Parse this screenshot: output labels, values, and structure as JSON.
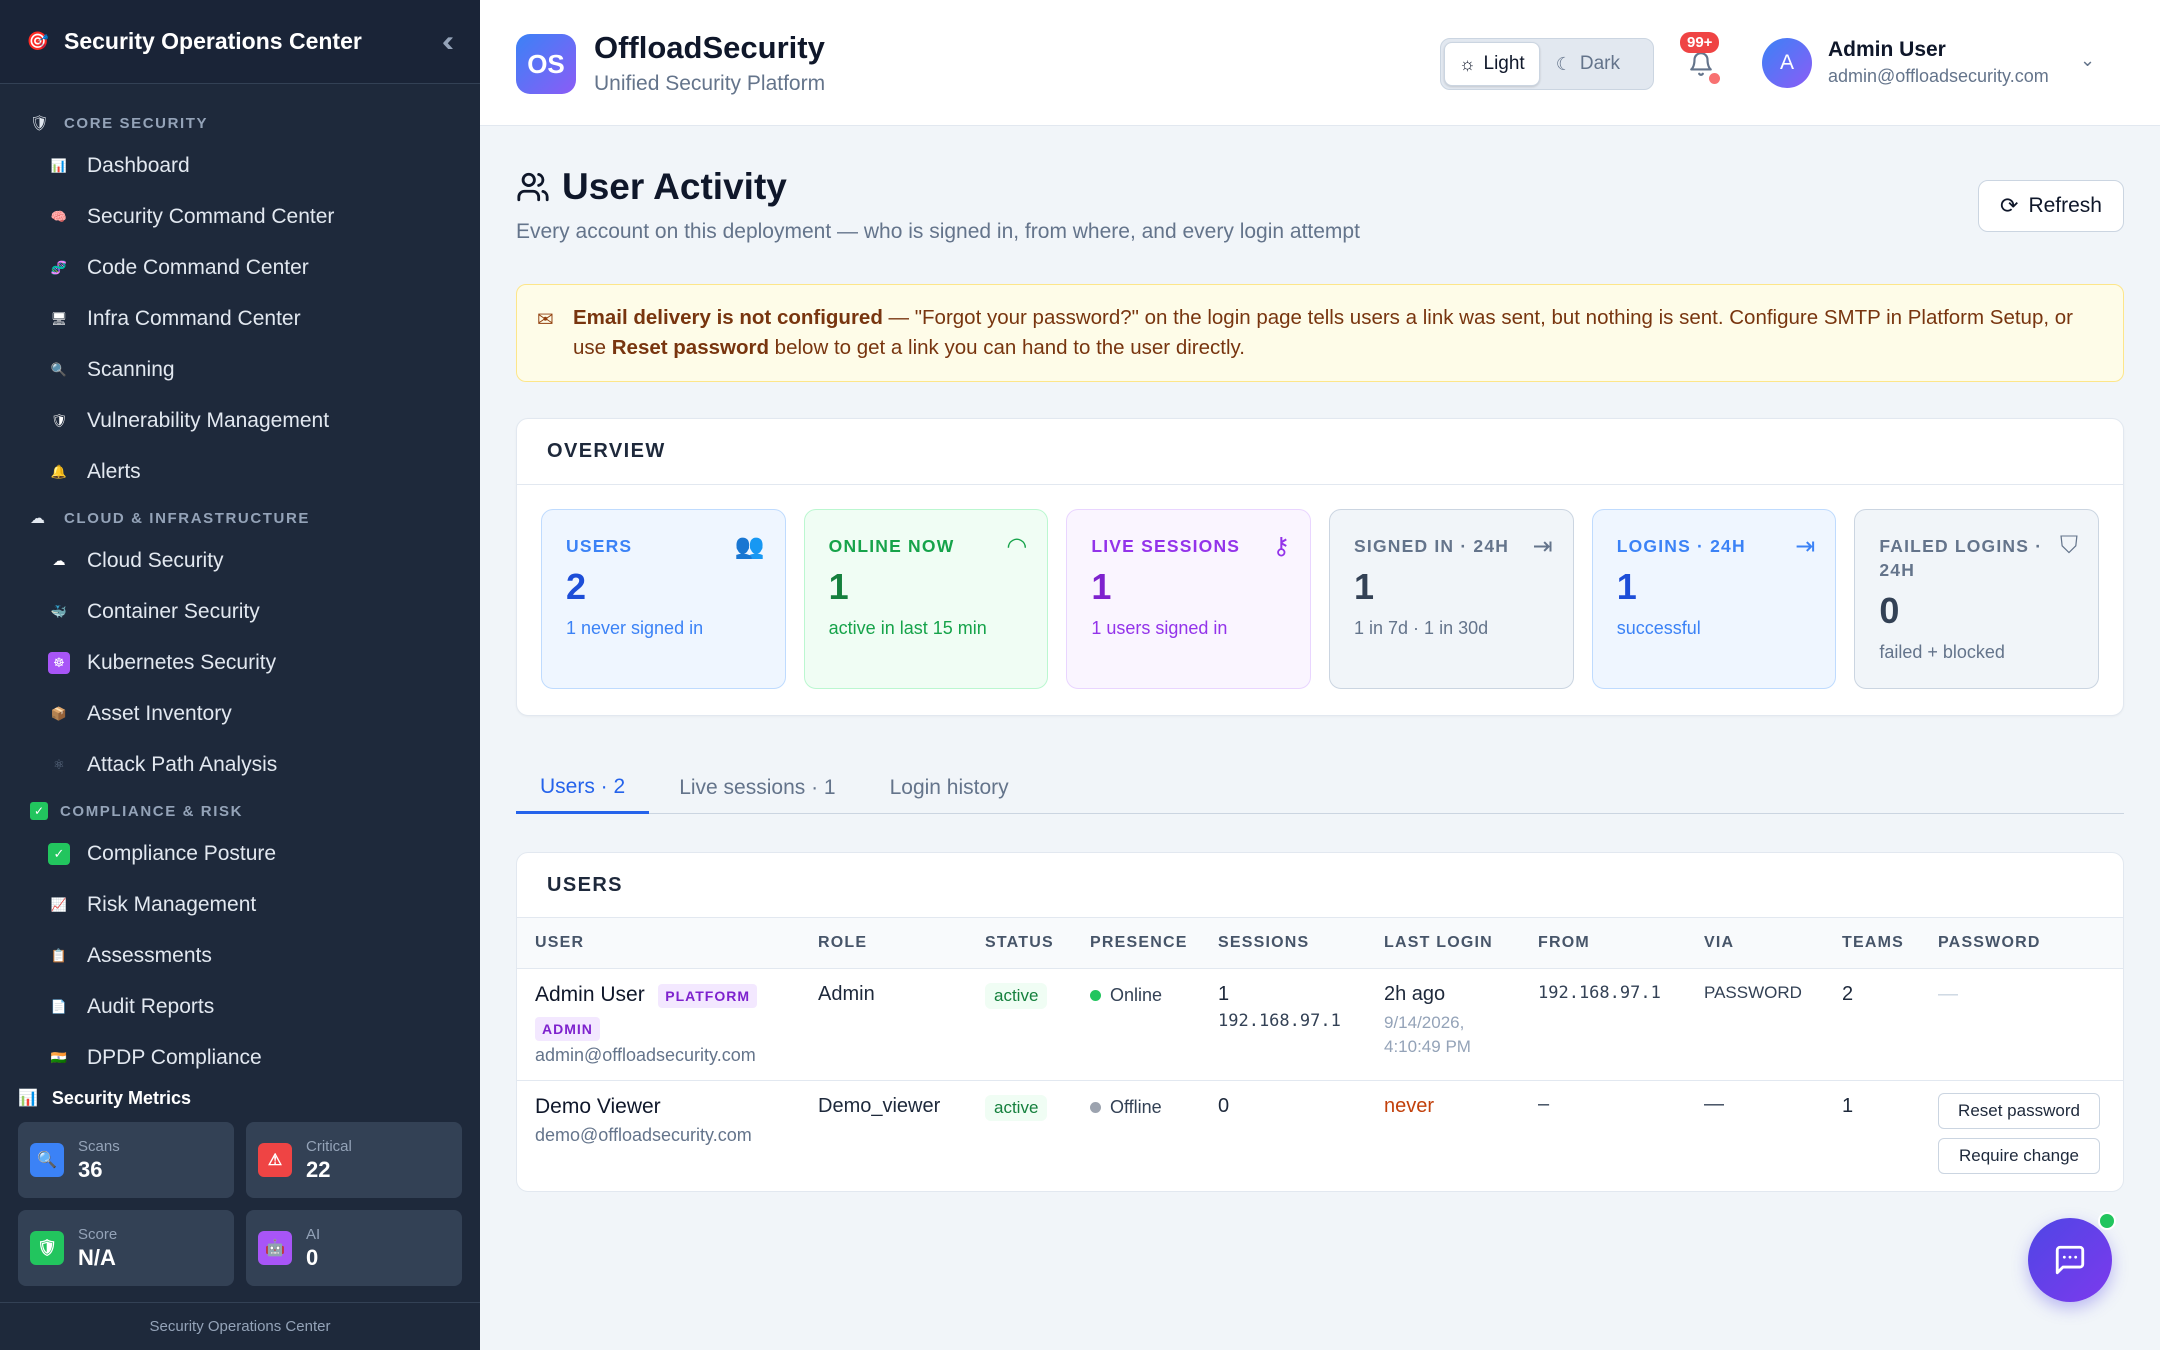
{
  "sidebar": {
    "title": "Security Operations Center",
    "sections": [
      {
        "label": "CORE SECURITY",
        "icon": "🛡",
        "items": [
          {
            "label": "Dashboard",
            "icon": "📊"
          },
          {
            "label": "Security Command Center",
            "icon": "🧠"
          },
          {
            "label": "Code Command Center",
            "icon": "🧬"
          },
          {
            "label": "Infra Command Center",
            "icon": "🖥"
          },
          {
            "label": "Scanning",
            "icon": "🔍"
          },
          {
            "label": "Vulnerability Management",
            "icon": "🛡"
          },
          {
            "label": "Alerts",
            "icon": "🔔"
          }
        ]
      },
      {
        "label": "CLOUD & INFRASTRUCTURE",
        "icon": "☁",
        "items": [
          {
            "label": "Cloud Security",
            "icon": "☁"
          },
          {
            "label": "Container Security",
            "icon": "🐳"
          },
          {
            "label": "Kubernetes Security",
            "icon": "☸"
          },
          {
            "label": "Asset Inventory",
            "icon": "📦"
          },
          {
            "label": "Attack Path Analysis",
            "icon": "⚛"
          }
        ]
      },
      {
        "label": "COMPLIANCE & RISK",
        "icon": "✓",
        "items": [
          {
            "label": "Compliance Posture",
            "icon": "✓"
          },
          {
            "label": "Risk Management",
            "icon": "📈"
          },
          {
            "label": "Assessments",
            "icon": "📋"
          },
          {
            "label": "Audit Reports",
            "icon": "📄"
          },
          {
            "label": "DPDP Compliance",
            "icon": "🇮🇳"
          }
        ]
      }
    ],
    "metrics": {
      "title": "Security Metrics",
      "cards": [
        {
          "key": "Scans",
          "value": "36",
          "color": "#3b82f6",
          "icon": "🔍"
        },
        {
          "key": "Critical",
          "value": "22",
          "color": "#ef4444",
          "icon": "⚠"
        },
        {
          "key": "Score",
          "value": "N/A",
          "color": "#22c55e",
          "icon": "🛡"
        },
        {
          "key": "AI",
          "value": "0",
          "color": "#a855f7",
          "icon": "🤖"
        }
      ]
    },
    "footer": "Security Operations Center"
  },
  "topbar": {
    "brand_badge": "OS",
    "brand_name": "OffloadSecurity",
    "brand_sub": "Unified Security Platform",
    "theme_light": "Light",
    "theme_dark": "Dark",
    "notif_count": "99+",
    "avatar_initial": "A",
    "user_name": "Admin User",
    "user_email": "admin@offloadsecurity.com"
  },
  "page": {
    "title": "User Activity",
    "description": "Every account on this deployment — who is signed in, from where, and every login attempt",
    "refresh": "Refresh"
  },
  "alert": {
    "strong1": "Email delivery is not configured",
    "text1": " — \"Forgot your password?\" on the login page tells users a link was sent, but nothing is sent. Configure SMTP in Platform Setup, or use ",
    "strong2": "Reset password",
    "text2": " below to get a link you can hand to the user directly."
  },
  "overview": {
    "title": "OVERVIEW",
    "cards": [
      {
        "label": "USERS",
        "value": "2",
        "sub": "1 never signed in"
      },
      {
        "label": "ONLINE NOW",
        "value": "1",
        "sub": "active in last 15 min"
      },
      {
        "label": "LIVE SESSIONS",
        "value": "1",
        "sub": "1 users signed in"
      },
      {
        "label": "SIGNED IN · 24H",
        "value": "1",
        "sub": "1 in 7d · 1 in 30d"
      },
      {
        "label": "LOGINS · 24H",
        "value": "1",
        "sub": "successful"
      },
      {
        "label": "FAILED LOGINS · 24H",
        "value": "0",
        "sub": "failed + blocked"
      }
    ]
  },
  "tabs": [
    "Users · 2",
    "Live sessions · 1",
    "Login history"
  ],
  "users": {
    "title": "USERS",
    "columns": [
      "USER",
      "ROLE",
      "STATUS",
      "PRESENCE",
      "SESSIONS",
      "LAST LOGIN",
      "FROM",
      "VIA",
      "TEAMS",
      "PASSWORD"
    ],
    "rows": [
      {
        "name": "Admin User",
        "badge1": "PLATFORM",
        "badge2": "ADMIN",
        "email": "admin@offloadsecurity.com",
        "role": "Admin",
        "status": "active",
        "presence": "Online",
        "sessions": "1",
        "session_ip": "192.168.97.1",
        "last_login": "2h ago",
        "last_login_date": "9/14/2026,",
        "last_login_time": "4:10:49 PM",
        "from": "192.168.97.1",
        "via": "PASSWORD",
        "teams": "2",
        "password": "—"
      },
      {
        "name": "Demo Viewer",
        "email": "demo@offloadsecurity.com",
        "role": "Demo_viewer",
        "status": "active",
        "presence": "Offline",
        "sessions": "0",
        "last_login": "never",
        "from": "–",
        "via": "—",
        "teams": "1",
        "action1": "Reset password",
        "action2": "Require change"
      }
    ]
  },
  "colors": {
    "accent": "#2563eb",
    "sidebar_bg": "#1e293b",
    "online": "#22c55e",
    "offline": "#9ca3af"
  }
}
